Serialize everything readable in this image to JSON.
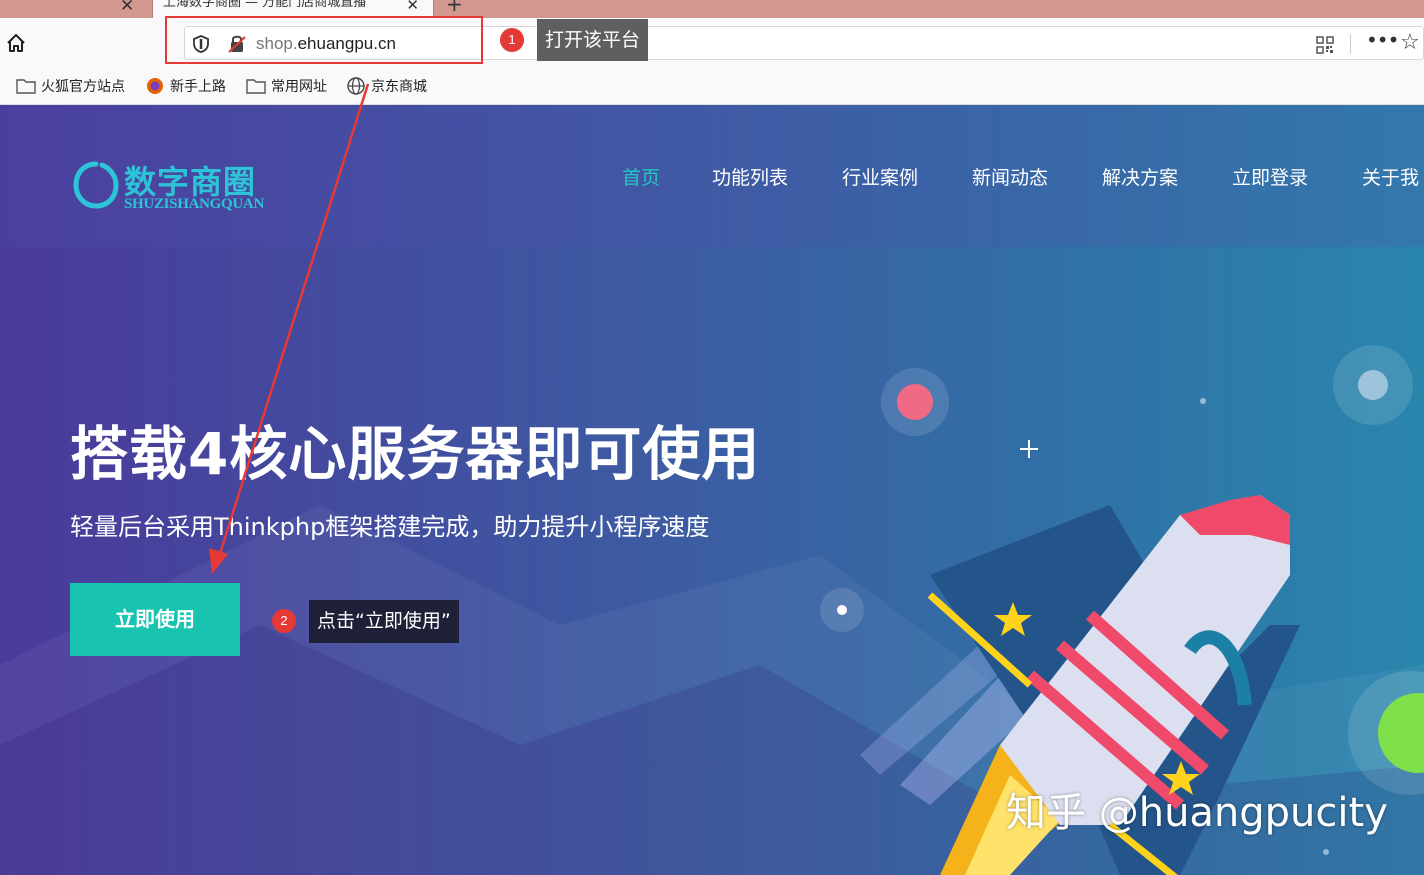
{
  "browser": {
    "tab_title": "上海数字商圈 — 万能门店商城直播",
    "url_host_prefix": "shop.",
    "url_host_main": "ehuangpu.cn",
    "bookmarks": [
      "火狐官方站点",
      "新手上路",
      "常用网址",
      "京东商城"
    ]
  },
  "annotations": {
    "step1_number": "1",
    "step1_text": "打开该平台",
    "step2_number": "2",
    "step2_text": "点击“立即使用”"
  },
  "site": {
    "logo_cn": "数字商圈",
    "logo_en": "SHUZISHANGQUAN",
    "menu": [
      "首页",
      "功能列表",
      "行业案例",
      "新闻动态",
      "解决方案",
      "立即登录",
      "关于我"
    ],
    "headline": "搭载4核心服务器即可使用",
    "subline": "轻量后台采用Thinkphp框架搭建完成，助力提升小程序速度",
    "cta_label": "立即使用"
  },
  "watermark": "知乎 @huangpucity",
  "colors": {
    "highlight_red": "#e53935",
    "menu_active": "#23c6c0",
    "cta": "#18c4b0",
    "logo": "#2ec4d8"
  }
}
